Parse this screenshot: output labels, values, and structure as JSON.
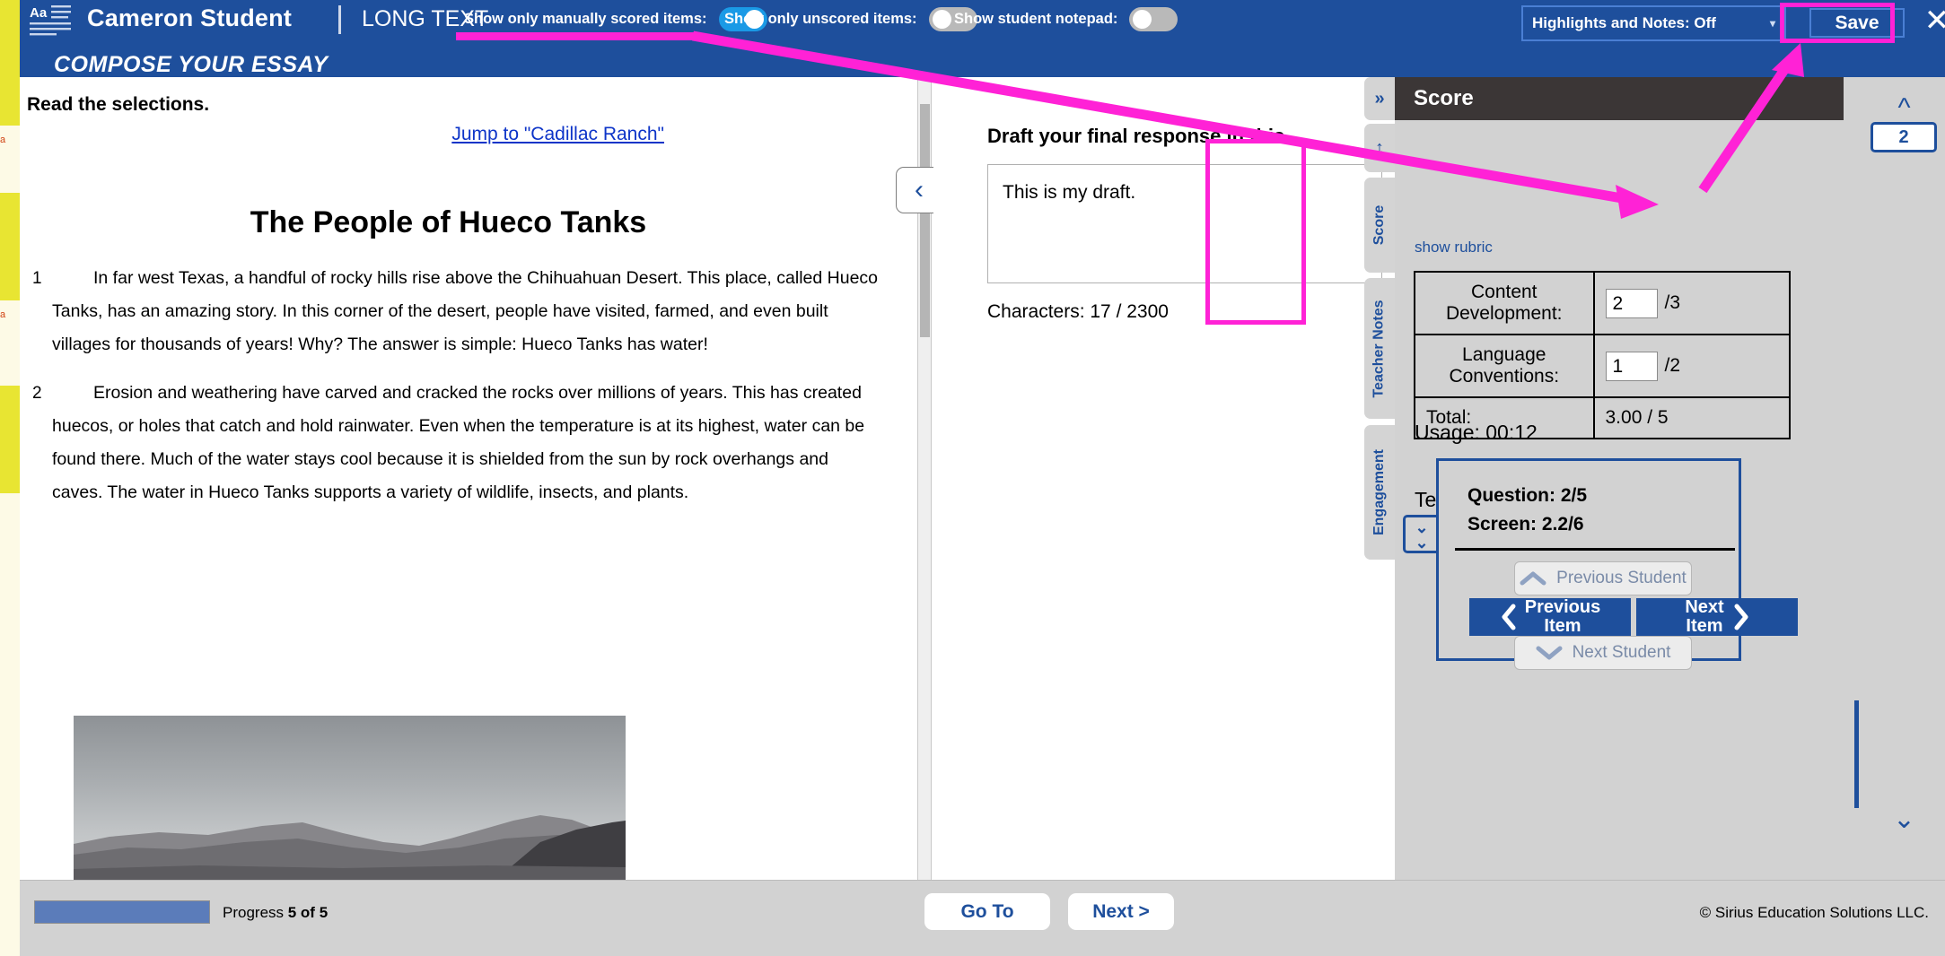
{
  "header": {
    "logo_icon": "text-lines-icon",
    "student_name": "Cameron Student",
    "item_type": "LONG TEXT",
    "section_title": "COMPOSE YOUR ESSAY",
    "toggles": [
      {
        "label": "Show only manually scored items:",
        "state": "on"
      },
      {
        "label": "Show only unscored items:",
        "state": "off"
      },
      {
        "label": "Show student notepad:",
        "state": "off"
      }
    ],
    "highlights_select": {
      "value": "Highlights and Notes: Off",
      "caret_icon": "chevron-down-icon"
    },
    "save_label": "Save",
    "close_icon": "close-icon"
  },
  "passage": {
    "instruction": "Read the selections.",
    "jump_link": "Jump to \"Cadillac Ranch\"",
    "title": "The People of Hueco Tanks",
    "paragraphs": [
      {
        "number": "1",
        "text": "In far west Texas, a handful of rocky hills rise above the Chihuahuan Desert. This place, called Hueco Tanks, has an amazing story. In this corner of the desert, people have visited, farmed, and even built villages for thousands of years! Why? The answer is simple: Hueco Tanks has water!"
      },
      {
        "number": "2",
        "text": "Erosion and weathering have carved and cracked the rocks over millions of years. This has created huecos, or holes that catch and hold rainwater. Even when the temperature is at its highest, water can be found there. Much of the water stays cool because it is shielded from the sun by rock overhangs and caves. The water in Hueco Tanks supports a variety of wildlife, insects, and plants."
      }
    ],
    "image_alt": "grayscale-desert-hills-photo",
    "prev_page_icon": "chevron-left-icon",
    "next_page_icon": "chevron-right-icon"
  },
  "draft": {
    "title": "Draft your final response in this",
    "value": "This is my draft.",
    "char_count": "Characters: 17 / 2300"
  },
  "vertical_tabs": [
    {
      "label": "»",
      "name": "expand"
    },
    {
      "label": "↕",
      "name": "resize"
    },
    {
      "label": "Score",
      "name": "score"
    },
    {
      "label": "Teacher Notes",
      "name": "teacher-notes"
    },
    {
      "label": "Engagement",
      "name": "engagement"
    }
  ],
  "score_panel": {
    "heading": "Score",
    "show_rubric": "show rubric",
    "rows": [
      {
        "label": "Content Development:",
        "value": "2",
        "max": "/3",
        "editable": true
      },
      {
        "label": "Language Conventions:",
        "value": "1",
        "max": "/2",
        "editable": true
      },
      {
        "label": "Total:",
        "value": "3.00 / 5",
        "max": "",
        "editable": false
      }
    ],
    "usage": "Usage: 00:12",
    "teacher_comments_label": "Teacher Comments:",
    "teacher_comments_value": "",
    "double_chevron_icon": "double-chevron-down-icon"
  },
  "nav_box": {
    "question": "Question: 2/5",
    "screen": "Screen: 2.2/6",
    "previous_student": "Previous Student",
    "next_student": "Next Student",
    "previous_item": "Previous\nItem",
    "previous_item_line1": "Previous",
    "previous_item_line2": "Item",
    "next_item_line1": "Next",
    "next_item_line2": "Item",
    "up_icon": "chevron-up-icon",
    "down_icon": "chevron-down-icon",
    "left_icon": "chevron-left-icon",
    "right_icon": "chevron-right-icon"
  },
  "rail": {
    "up_icon": "chevron-up-icon",
    "down_icon": "chevron-down-icon",
    "badge": "2"
  },
  "footer": {
    "progress_label_prefix": "Progress ",
    "progress_value": "5 of 5",
    "progress_percent": 100,
    "go_to": "Go To",
    "next": "Next >",
    "copyright": "© Sirius Education Solutions LLC."
  },
  "annotations": {
    "color": "#ff22d6",
    "marks": [
      "underline-manual-toggle",
      "arrow-to-score-cell",
      "box-score-values",
      "box-save-button",
      "arrow-to-save"
    ]
  }
}
